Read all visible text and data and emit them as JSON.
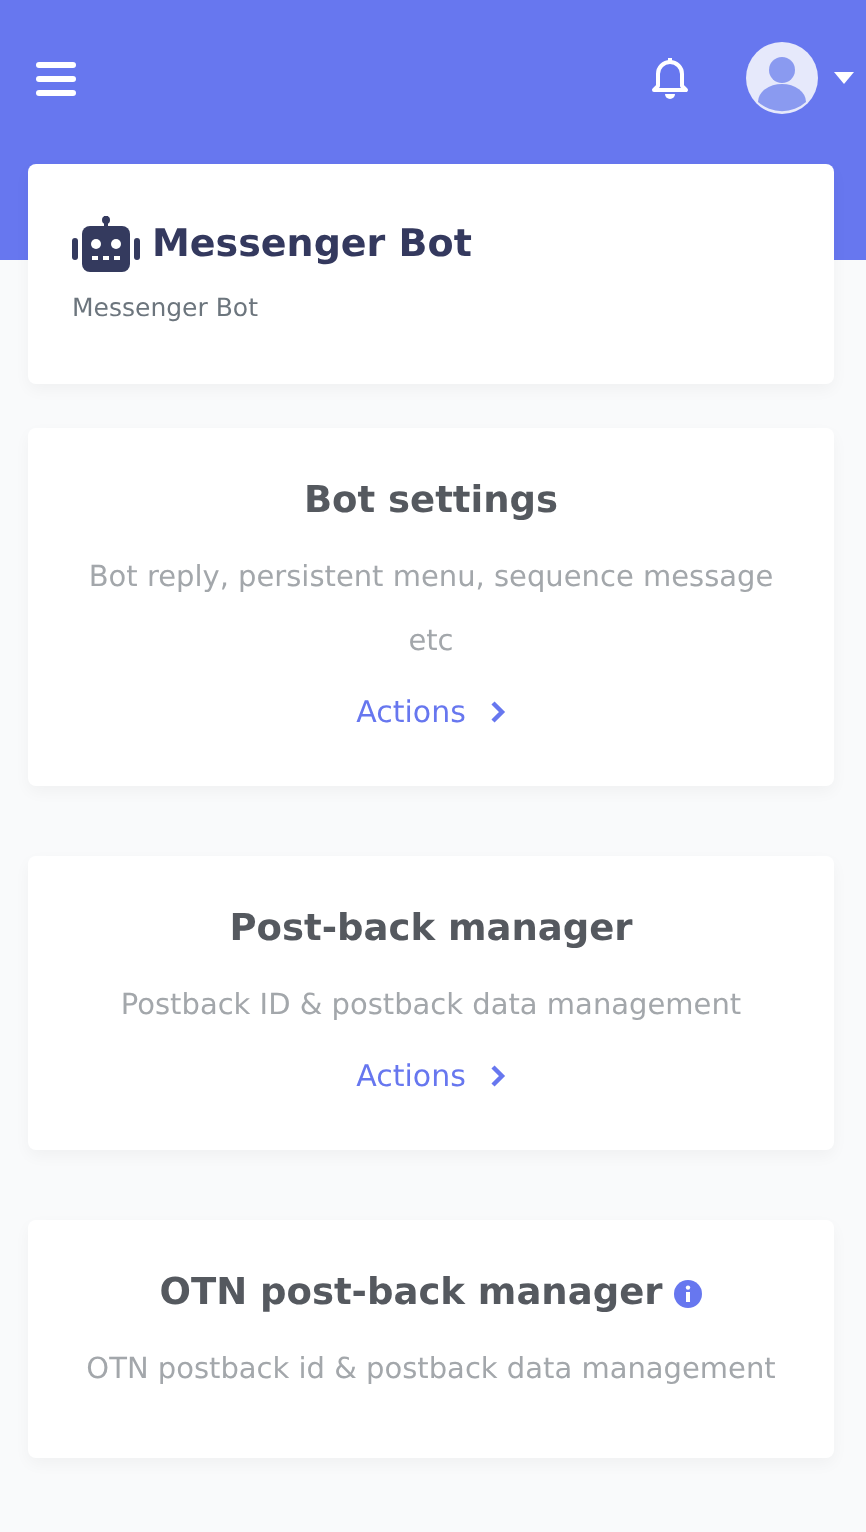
{
  "header": {
    "title": "Messenger Bot",
    "subtitle": "Messenger Bot"
  },
  "cards": [
    {
      "title": "Bot settings",
      "description": "Bot reply, persistent menu, sequence message etc",
      "action": "Actions",
      "info_icon": false
    },
    {
      "title": "Post-back manager",
      "description": "Postback ID & postback data management",
      "action": "Actions",
      "info_icon": false
    },
    {
      "title": "OTN post-back manager",
      "description": "OTN postback id & postback data management",
      "info_icon": true
    }
  ]
}
